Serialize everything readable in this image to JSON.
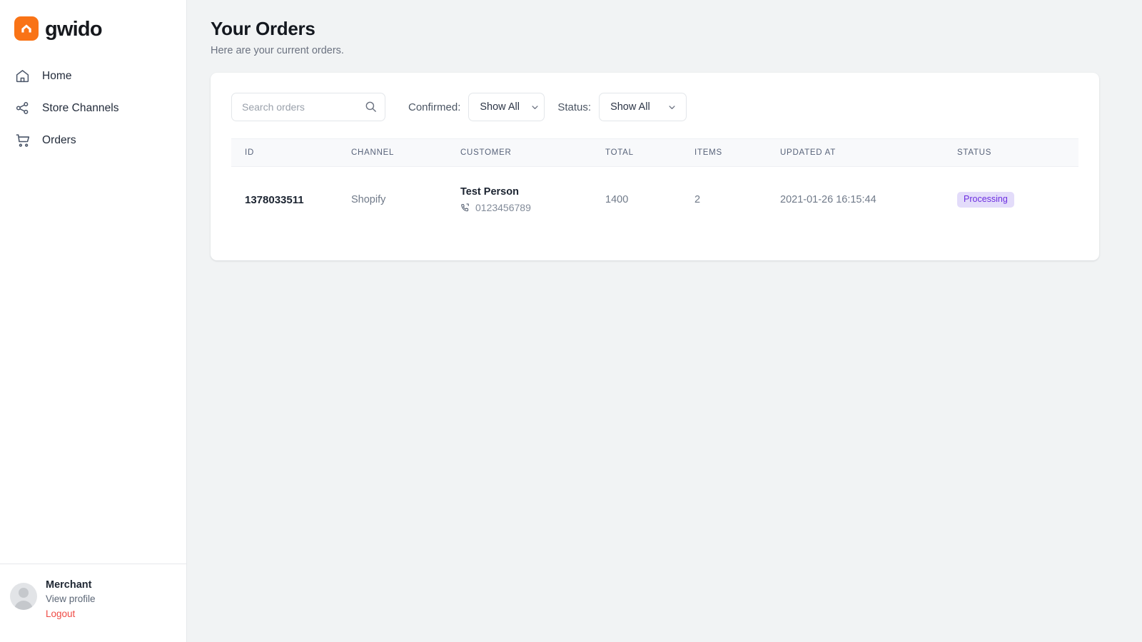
{
  "brand": {
    "name": "gwido",
    "logo_icon": "house-chevron-icon",
    "accent_color": "#f97316"
  },
  "sidebar": {
    "items": [
      {
        "label": "Home",
        "icon": "home-icon"
      },
      {
        "label": "Store Channels",
        "icon": "share-nodes-icon"
      },
      {
        "label": "Orders",
        "icon": "shopping-cart-icon"
      }
    ],
    "profile": {
      "name": "Merchant",
      "view_profile_label": "View profile",
      "logout_label": "Logout",
      "logout_color": "#ef4a44",
      "avatar_icon": "user-avatar-icon"
    }
  },
  "header": {
    "title": "Your Orders",
    "subtitle": "Here are your current orders."
  },
  "filters": {
    "search": {
      "placeholder": "Search orders",
      "value": "",
      "icon": "search-icon"
    },
    "confirmed": {
      "label": "Confirmed:",
      "value": "Show All",
      "icon": "chevron-down-icon"
    },
    "status": {
      "label": "Status:",
      "value": "Show All",
      "icon": "chevron-down-icon"
    }
  },
  "table": {
    "columns": [
      "ID",
      "CHANNEL",
      "CUSTOMER",
      "TOTAL",
      "ITEMS",
      "UPDATED AT",
      "STATUS"
    ],
    "rows": [
      {
        "id": "1378033511",
        "channel": "Shopify",
        "customer_name": "Test Person",
        "customer_phone": "0123456789",
        "phone_icon": "phone-icon",
        "total": "1400",
        "items": "2",
        "updated_at": "2021-01-26 16:15:44",
        "status": "Processing",
        "status_bg": "#e3dcfa",
        "status_fg": "#6d2ee0"
      }
    ]
  }
}
